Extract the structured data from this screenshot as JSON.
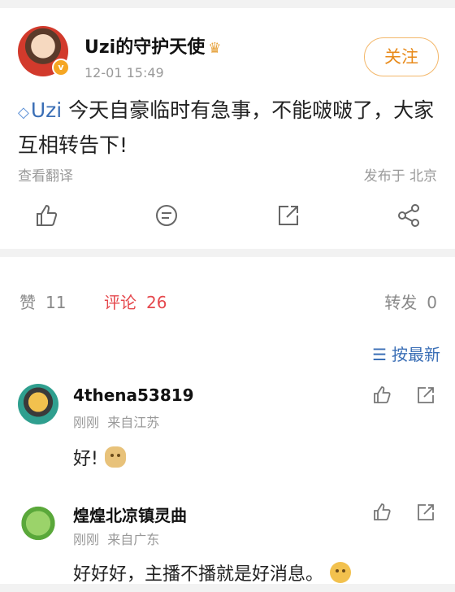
{
  "post": {
    "author": "Uzi的守护天使",
    "time": "12-01 15:49",
    "follow_label": "关注",
    "mention": "Uzi",
    "text_line1": "今天自豪临时有急事，不能啵啵了，大家",
    "text_line2": "互相转告下!",
    "translate_label": "查看翻译",
    "location": "发布于 北京",
    "actions": [
      "like-icon",
      "comment-icon",
      "share-icon",
      "more-share-icon"
    ]
  },
  "stats": {
    "likes_label": "赞",
    "likes_count": "11",
    "comments_label": "评论",
    "comments_count": "26",
    "reposts_label": "转发",
    "reposts_count": "0"
  },
  "sort_label": "按最新",
  "comments": [
    {
      "name": "4thena53819",
      "time": "刚刚",
      "from": "来自江苏",
      "text": "好!",
      "emoji": "doge-emoji"
    },
    {
      "name": "煌煌北凉镇灵曲",
      "time": "刚刚",
      "from": "来自广东",
      "text": "好好好，主播不播就是好消息。",
      "emoji": "smile-emoji"
    }
  ],
  "colors": {
    "accent": "#e5484d",
    "link": "#3b6fb6",
    "follow": "#e88a1a"
  }
}
